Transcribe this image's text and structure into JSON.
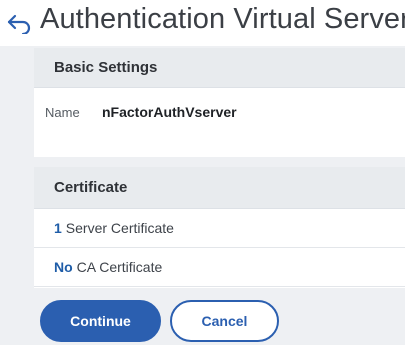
{
  "header": {
    "title": "Authentication Virtual Server",
    "back_icon": "back-arrow-icon"
  },
  "basic_settings": {
    "heading": "Basic Settings",
    "name_label": "Name",
    "name_value": "nFactorAuthVserver"
  },
  "certificate": {
    "heading": "Certificate",
    "rows": [
      {
        "count": "1",
        "label": "Server Certificate"
      },
      {
        "count": "No",
        "label": "CA Certificate"
      }
    ]
  },
  "actions": {
    "continue_label": "Continue",
    "cancel_label": "Cancel"
  },
  "colors": {
    "accent": "#2b5fb0",
    "header_bg": "#e8ebee"
  }
}
